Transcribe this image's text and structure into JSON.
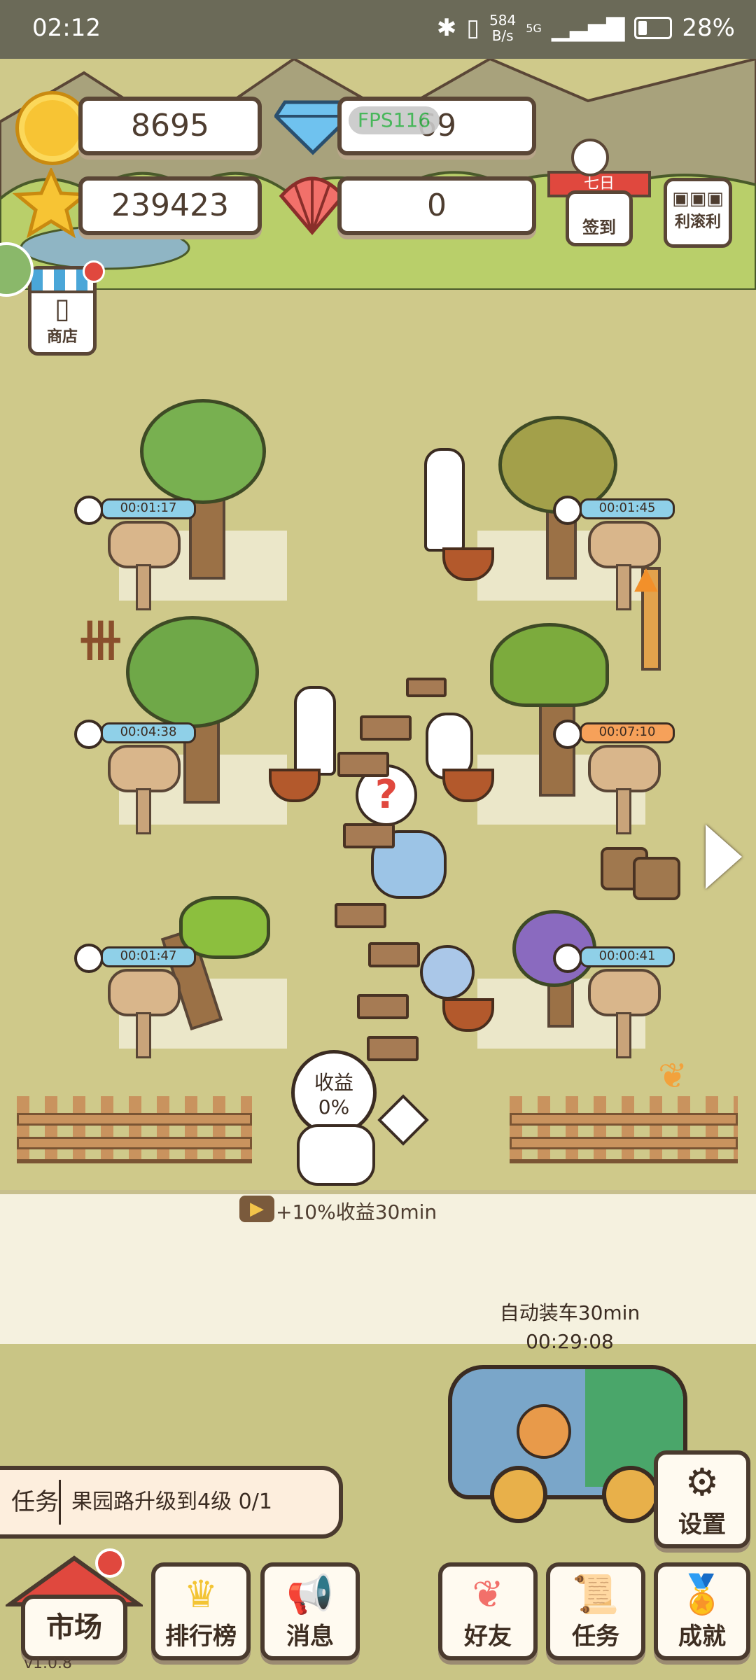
{
  "status_bar": {
    "time": "02:12",
    "net_speed_top": "584",
    "net_speed_bottom": "B/s",
    "network": "5G",
    "battery": "28%"
  },
  "resources": {
    "coins": "8695",
    "diamonds": "69",
    "fps_overlay": "FPS116",
    "stars": "239423",
    "shells": "0"
  },
  "top_buttons": {
    "seven_day_banner": "七日",
    "checkin": "签到",
    "gunli": "利滚利",
    "shop": "商店"
  },
  "timers": {
    "apple_tree_1": "00:01:17",
    "star_fruit_tree": "00:01:45",
    "apple_tree_2": "00:04:38",
    "durian_tree": "00:07:10",
    "coconut_tree": "00:01:47",
    "grape_tree": "00:00:41"
  },
  "farm": {
    "bubble_mark": "?",
    "income_label": "收益",
    "income_value": "0%"
  },
  "boost": {
    "label": "+10%收益30min"
  },
  "truck": {
    "auto_load_label": "自动装车30min",
    "countdown": "00:29:08"
  },
  "task_bar": {
    "label": "任务",
    "text": "果园路升级到4级 0/1"
  },
  "settings_label": "设置",
  "bottom_nav": {
    "market": "市场",
    "ranking": "排行榜",
    "messages": "消息",
    "friends": "好友",
    "tasks": "任务",
    "achievements": "成就"
  },
  "version": "v1.0.8",
  "colors": {
    "grass": "#cfc98a",
    "panel_border": "#5a4636",
    "accent_red": "#e0483e"
  }
}
